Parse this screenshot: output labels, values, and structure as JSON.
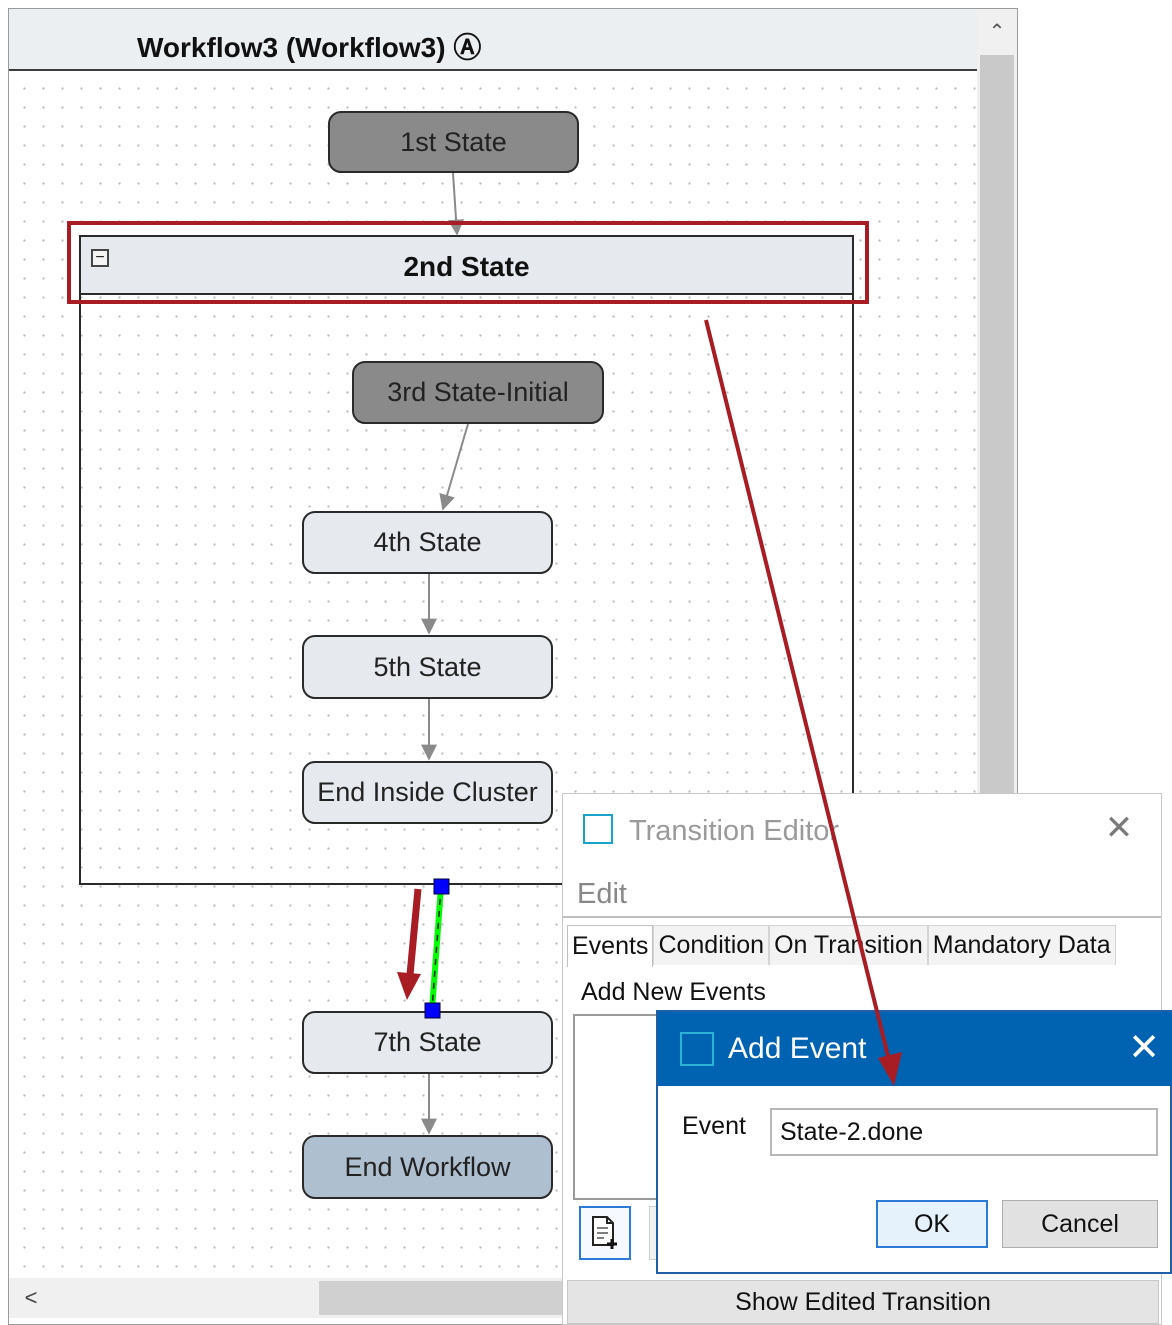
{
  "workflow": {
    "title": "Workflow3 (Workflow3) Ⓐ",
    "scroll": {
      "up_icon": "chevron-up-icon",
      "up_glyph": "⌃",
      "left_icon": "chevron-left-icon",
      "left_glyph": "<"
    },
    "states": {
      "first": "1st State",
      "third": "3rd State-Initial",
      "fourth": "4th State",
      "fifth": "5th State",
      "end_inside": "End Inside Cluster",
      "seventh": "7th State",
      "end_workflow": "End Workflow"
    },
    "cluster": {
      "title": "2nd State",
      "collapse_glyph": "−"
    }
  },
  "annotations": {
    "highlight_color": "#a81c24",
    "arrow_color": "#a81c24",
    "selected_transition_color": "#00ff00",
    "handle_color": "#0000ff"
  },
  "transition_editor": {
    "title": "Transition Editor",
    "close_glyph": "✕",
    "edit_label": "Edit",
    "tabs": [
      "Events",
      "Condition",
      "On Transition",
      "Mandatory Data"
    ],
    "active_tab": "Events",
    "add_new_events_label": "Add New Events",
    "show_edited_button": "Show Edited Transition"
  },
  "add_event_dialog": {
    "title": "Add Event",
    "close_glyph": "✕",
    "title_bar_color": "#0063b1",
    "event_label": "Event",
    "event_value": "State-2.done",
    "ok_label": "OK",
    "cancel_label": "Cancel"
  }
}
